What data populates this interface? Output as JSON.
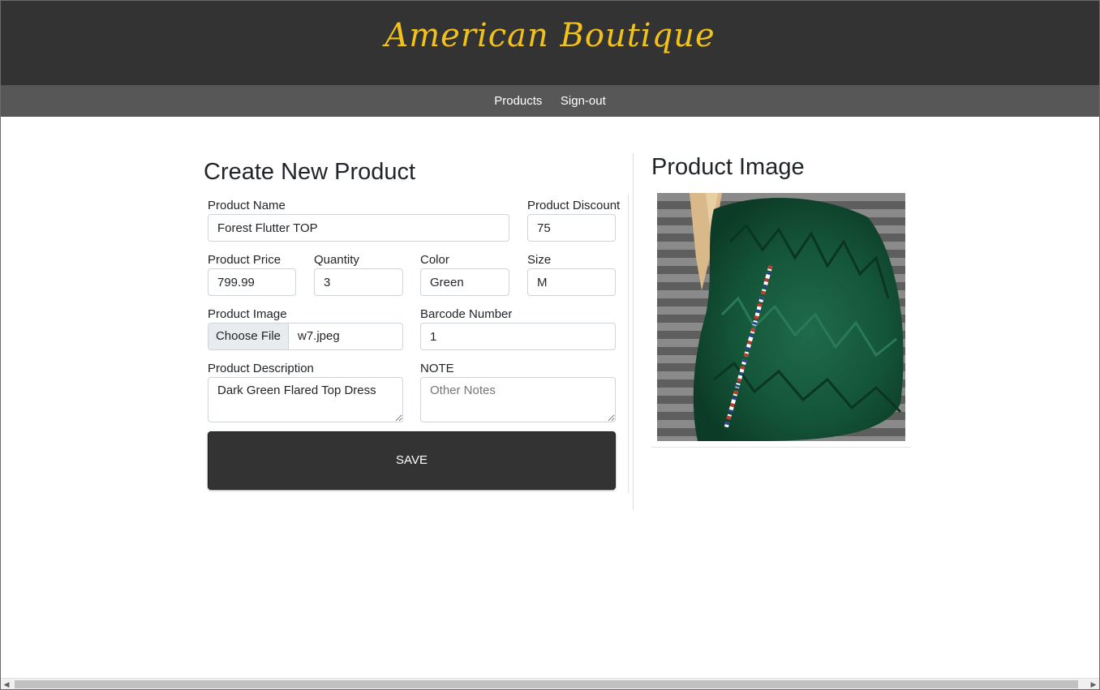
{
  "brand": "American Boutique",
  "nav": {
    "products": "Products",
    "signout": "Sign-out"
  },
  "form": {
    "title": "Create New Product",
    "product_name": {
      "label": "Product Name",
      "value": "Forest Flutter TOP"
    },
    "product_discount": {
      "label": "Product Discount",
      "value": "75"
    },
    "product_price": {
      "label": "Product Price",
      "value": "799.99"
    },
    "quantity": {
      "label": "Quantity",
      "value": "3"
    },
    "color": {
      "label": "Color",
      "value": "Green"
    },
    "size": {
      "label": "Size",
      "value": "M"
    },
    "product_image": {
      "label": "Product Image",
      "button": "Choose File",
      "filename": "w7.jpeg"
    },
    "barcode": {
      "label": "Barcode Number",
      "value": "1"
    },
    "description": {
      "label": "Product Description",
      "value": "Dark Green Flared Top Dress"
    },
    "note": {
      "label": "NOTE",
      "value": "",
      "placeholder": "Other Notes"
    },
    "save": "SAVE"
  },
  "preview": {
    "title": "Product Image"
  },
  "colors": {
    "header_bg": "#333333",
    "nav_bg": "#575757",
    "brand": "#f2c21a",
    "button_bg": "#333333"
  }
}
